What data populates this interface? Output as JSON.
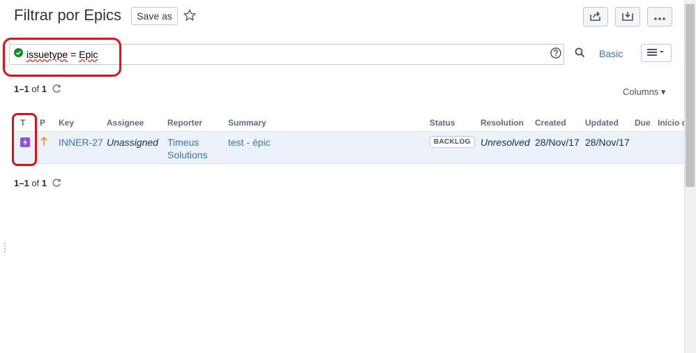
{
  "header": {
    "title": "Filtrar por Epics",
    "save_as_label": "Save as"
  },
  "search": {
    "query_field": "issuetype",
    "query_rest": " = ",
    "query_value": "Epic",
    "mode_label": "Basic"
  },
  "pager_top": {
    "range": "1–1",
    "of": " of ",
    "total": "1"
  },
  "pager_bottom": {
    "range": "1–1",
    "of": " of ",
    "total": "1"
  },
  "columns_label": "Columns",
  "table": {
    "headers": {
      "type": "T",
      "priority": "P",
      "key": "Key",
      "assignee": "Assignee",
      "reporter": "Reporter",
      "summary": "Summary",
      "status": "Status",
      "resolution": "Resolution",
      "created": "Created",
      "updated": "Updated",
      "due": "Due",
      "extra": "Início d"
    },
    "rows": [
      {
        "key": "INNER-27",
        "assignee": "Unassigned",
        "reporter_line1": "Timeus",
        "reporter_line2": "Solutions",
        "summary": "test - épic",
        "status": "BACKLOG",
        "resolution": "Unresolved",
        "created": "28/Nov/17",
        "updated": "28/Nov/17"
      }
    ]
  },
  "colors": {
    "accent": "#3b73af",
    "epic": "#904ee2",
    "priority_high": "#f79232",
    "highlight": "#e0101a",
    "valid": "#14892c"
  },
  "icons": [
    "star-icon",
    "share-icon",
    "export-icon",
    "more-icon",
    "valid-check-icon",
    "help-icon",
    "search-icon",
    "list-menu-icon",
    "refresh-icon",
    "epic-type-icon",
    "priority-arrow-icon"
  ]
}
